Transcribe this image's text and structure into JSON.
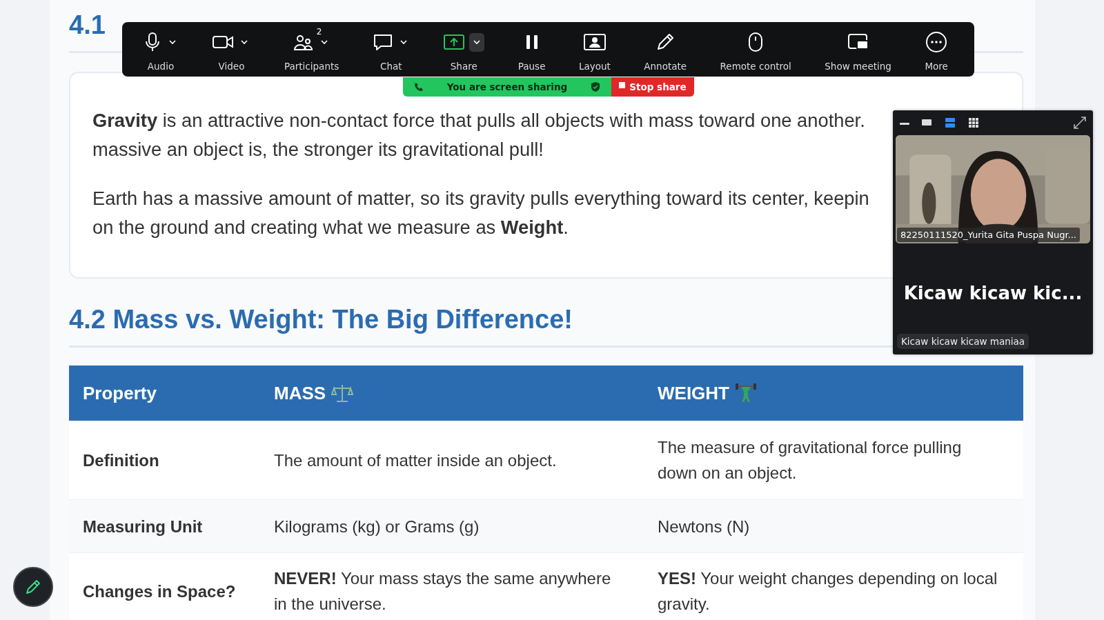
{
  "page": {
    "section_1": {
      "heading": "4.1",
      "paragraphs": [
        {
          "lines": [
            "**Gravity** is an attractive non-contact force that pulls all objects with mass toward one another.",
            "massive an object is, the stronger its gravitational pull!"
          ]
        },
        {
          "lines": [
            "Earth has a massive amount of matter, so its gravity pulls everything toward its center, keepin",
            "on the ground and creating what we measure as **Weight**."
          ]
        }
      ]
    },
    "section_2": {
      "heading": "4.2 Mass vs. Weight: The Big Difference!",
      "table": {
        "columns": [
          "Property",
          "MASS",
          "WEIGHT"
        ],
        "rows": [
          {
            "cells": [
              "Definition",
              "The amount of matter inside an object.",
              "The measure of gravitational force pulling down on an object."
            ]
          },
          {
            "cells": [
              "Measuring Unit",
              "Kilograms (kg) or Grams (g)",
              "Newtons (N)"
            ]
          },
          {
            "cells": [
              "Changes in Space?",
              "**NEVER!** Your mass stays the same anywhere in the universe.",
              "**YES!** Your weight changes depending on local gravity."
            ]
          }
        ]
      }
    }
  },
  "meeting_toolbar": {
    "items": [
      {
        "kind": "audio",
        "label": "Audio",
        "caret": true
      },
      {
        "kind": "video",
        "label": "Video",
        "caret": true
      },
      {
        "kind": "participants",
        "label": "Participants",
        "caret": true,
        "count": "2"
      },
      {
        "kind": "chat",
        "label": "Chat",
        "caret": true
      },
      {
        "kind": "share",
        "label": "Share",
        "caret": true
      },
      {
        "kind": "pause",
        "label": "Pause",
        "caret": false
      },
      {
        "kind": "layout",
        "label": "Layout",
        "caret": false
      },
      {
        "kind": "annotate",
        "label": "Annotate",
        "caret": false
      },
      {
        "kind": "remote",
        "label": "Remote control",
        "caret": false
      },
      {
        "kind": "show",
        "label": "Show meeting",
        "caret": false
      },
      {
        "kind": "more",
        "label": "More",
        "caret": false
      }
    ]
  },
  "sharing_banner": {
    "text": "You are screen sharing",
    "stop_label": "Stop share"
  },
  "video_panel": {
    "view_modes": [
      {
        "kind": "minimize",
        "selected": false
      },
      {
        "kind": "thumbnail",
        "selected": false
      },
      {
        "kind": "speaker",
        "selected": true
      },
      {
        "kind": "gallery",
        "selected": false
      }
    ],
    "tiles": [
      {
        "kind": "video",
        "name": "82250111520_Yurita Gita Puspa Nugr..."
      },
      {
        "kind": "text",
        "display": "Kicaw kicaw kic...",
        "name": "Kicaw kicaw kicaw maniaa"
      }
    ]
  }
}
